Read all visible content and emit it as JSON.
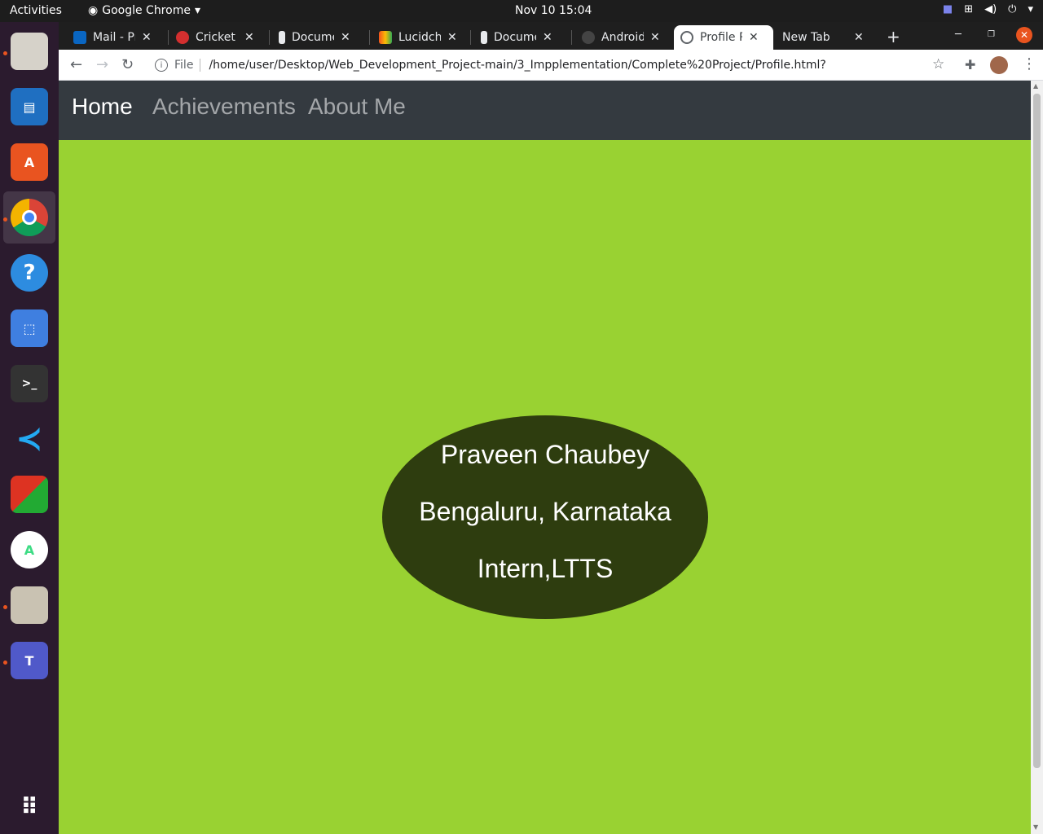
{
  "topbar": {
    "activities": "Activities",
    "app_name": "Google Chrome",
    "clock": "Nov 10  15:04"
  },
  "dock": {
    "items": [
      "files-icon",
      "libreoffice-impress-icon",
      "software-center-icon",
      "chrome-icon",
      "help-icon",
      "screenshot-icon",
      "terminal-icon",
      "vscode-icon",
      "game-icon",
      "android-studio-icon",
      "archive-icon",
      "teams-icon"
    ]
  },
  "browser": {
    "tabs": [
      {
        "title": "Mail - Pra",
        "icon": "outlook-icon",
        "color": "#0a66c2"
      },
      {
        "title": "Cricket s",
        "icon": "cricket-icon",
        "color": "#d32f2f"
      },
      {
        "title": "Docume",
        "icon": "docs-icon",
        "color": "#222222"
      },
      {
        "title": "Lucidcha",
        "icon": "lucidchart-icon",
        "color": "#f4511e"
      },
      {
        "title": "Docume",
        "icon": "docs-icon",
        "color": "#222222"
      },
      {
        "title": "Android",
        "icon": "github-icon",
        "color": "#333333"
      },
      {
        "title": "Profile P",
        "icon": "globe-icon",
        "color": "#5f6368"
      },
      {
        "title": "New Tab",
        "icon": "",
        "color": ""
      }
    ],
    "url_scheme": "File",
    "url": "/home/user/Desktop/Web_Development_Project-main/3_Impplementation/Complete%20Project/Profile.html?"
  },
  "page": {
    "nav": {
      "home": "Home",
      "achievements": "Achievements",
      "about": "About Me"
    },
    "profile": {
      "name": "Praveen Chaubey",
      "location": "Bengaluru, Karnataka",
      "role": "Intern,LTTS"
    },
    "colors": {
      "background": "#99d232",
      "navbar": "#343a40",
      "ellipse": "#2e3d0f"
    }
  }
}
